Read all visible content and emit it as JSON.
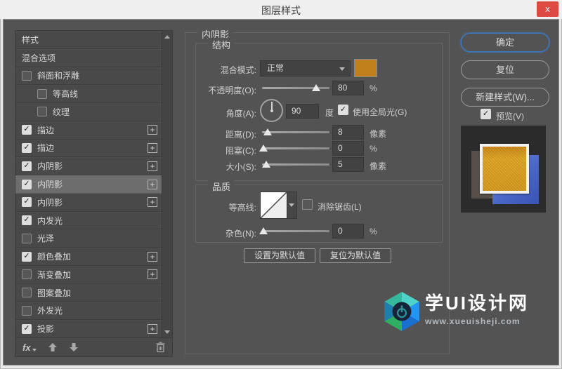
{
  "window": {
    "title": "图层样式"
  },
  "glyphs": {
    "check": "✓",
    "plus": "+",
    "close": "x"
  },
  "sidebar": {
    "items": [
      {
        "label": "样式",
        "checkbox": "none",
        "plus": false,
        "indent": false,
        "selected": false
      },
      {
        "label": "混合选项",
        "checkbox": "none",
        "plus": false,
        "indent": false,
        "selected": false
      },
      {
        "label": "斜面和浮雕",
        "checkbox": "unchecked",
        "plus": false,
        "indent": false,
        "selected": false
      },
      {
        "label": "等高线",
        "checkbox": "unchecked",
        "plus": false,
        "indent": true,
        "selected": false
      },
      {
        "label": "纹理",
        "checkbox": "unchecked",
        "plus": false,
        "indent": true,
        "selected": false
      },
      {
        "label": "描边",
        "checkbox": "checked",
        "plus": true,
        "indent": false,
        "selected": false
      },
      {
        "label": "描边",
        "checkbox": "checked",
        "plus": true,
        "indent": false,
        "selected": false
      },
      {
        "label": "内阴影",
        "checkbox": "checked",
        "plus": true,
        "indent": false,
        "selected": false
      },
      {
        "label": "内阴影",
        "checkbox": "checked",
        "plus": true,
        "indent": false,
        "selected": true
      },
      {
        "label": "内阴影",
        "checkbox": "checked",
        "plus": true,
        "indent": false,
        "selected": false
      },
      {
        "label": "内发光",
        "checkbox": "checked",
        "plus": false,
        "indent": false,
        "selected": false
      },
      {
        "label": "光泽",
        "checkbox": "unchecked",
        "plus": false,
        "indent": false,
        "selected": false
      },
      {
        "label": "颜色叠加",
        "checkbox": "checked",
        "plus": true,
        "indent": false,
        "selected": false
      },
      {
        "label": "渐变叠加",
        "checkbox": "unchecked",
        "plus": true,
        "indent": false,
        "selected": false
      },
      {
        "label": "图案叠加",
        "checkbox": "unchecked",
        "plus": false,
        "indent": false,
        "selected": false
      },
      {
        "label": "外发光",
        "checkbox": "unchecked",
        "plus": false,
        "indent": false,
        "selected": false
      },
      {
        "label": "投影",
        "checkbox": "checked",
        "plus": true,
        "indent": false,
        "selected": false
      }
    ],
    "fx_label": "fx"
  },
  "panel": {
    "legend": "内阴影",
    "structure": {
      "legend": "结构",
      "blend_mode_label": "混合模式:",
      "blend_mode_value": "正常",
      "swatch_color": "#c0811c",
      "opacity_label": "不透明度(O):",
      "opacity_value": "80",
      "opacity_unit": "%",
      "angle_label": "角度(A):",
      "angle_value": "90",
      "angle_unit": "度",
      "global_light_label": "使用全局光(G)",
      "distance_label": "距离(D):",
      "distance_value": "8",
      "distance_unit": "像素",
      "choke_label": "阻塞(C):",
      "choke_value": "0",
      "choke_unit": "%",
      "size_label": "大小(S):",
      "size_value": "5",
      "size_unit": "像素"
    },
    "quality": {
      "legend": "品质",
      "contour_label": "等高线:",
      "anti_alias_label": "消除锯齿(L)",
      "noise_label": "杂色(N):",
      "noise_value": "0",
      "noise_unit": "%"
    },
    "make_default_label": "设置为默认值",
    "reset_default_label": "复位为默认值"
  },
  "actions": {
    "ok": "确定",
    "reset": "复位",
    "new_style": "新建样式(W)...",
    "preview": "预览(V)"
  },
  "watermark": {
    "name": "学UI设计网",
    "url": "www.xueuisheji.com"
  }
}
